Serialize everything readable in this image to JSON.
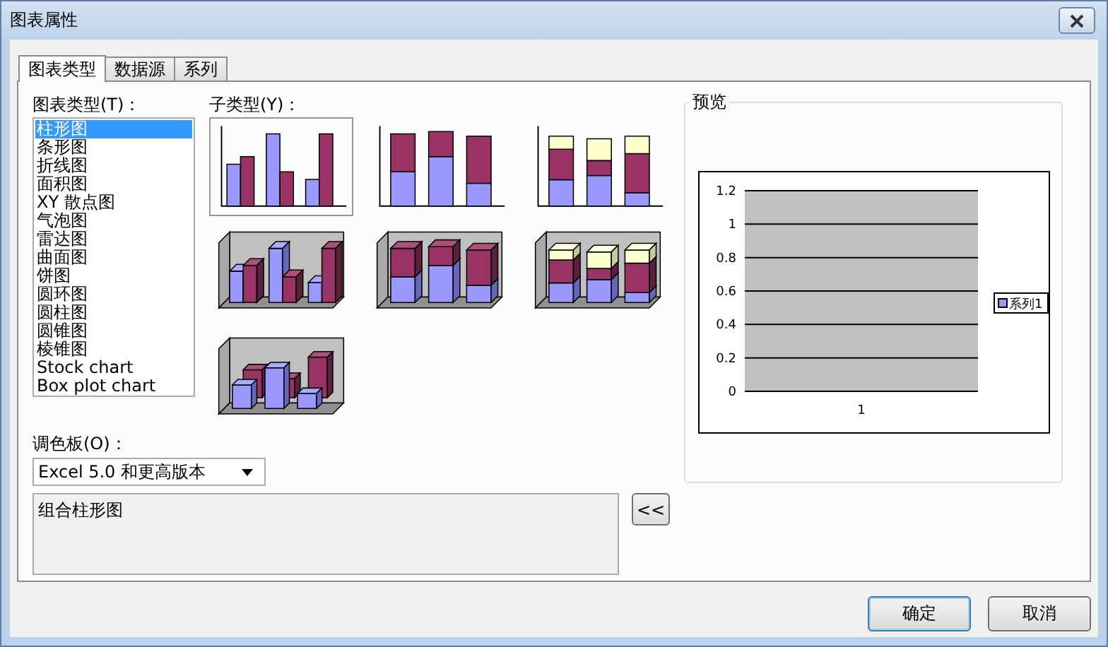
{
  "window": {
    "title": "图表属性"
  },
  "tabs": [
    {
      "label": "图表类型",
      "selected": true
    },
    {
      "label": "数据源",
      "selected": false
    },
    {
      "label": "系列",
      "selected": false
    }
  ],
  "chart_types": {
    "label": "图表类型(T)：",
    "items": [
      {
        "label": "柱形图",
        "selected": true
      },
      {
        "label": "条形图",
        "selected": false
      },
      {
        "label": "折线图",
        "selected": false
      },
      {
        "label": "面积图",
        "selected": false
      },
      {
        "label": "XY 散点图",
        "selected": false
      },
      {
        "label": "气泡图",
        "selected": false
      },
      {
        "label": "雷达图",
        "selected": false
      },
      {
        "label": "曲面图",
        "selected": false
      },
      {
        "label": "饼图",
        "selected": false
      },
      {
        "label": "圆环图",
        "selected": false
      },
      {
        "label": "圆柱图",
        "selected": false
      },
      {
        "label": "圆锥图",
        "selected": false
      },
      {
        "label": "棱锥图",
        "selected": false
      },
      {
        "label": "Stock chart",
        "selected": false
      },
      {
        "label": "Box plot chart",
        "selected": false
      }
    ]
  },
  "subtypes": {
    "label": "子类型(Y)：",
    "items": [
      {
        "kind": "clustered",
        "selected": true
      },
      {
        "kind": "stacked",
        "selected": false
      },
      {
        "kind": "percent",
        "selected": false
      },
      {
        "kind": "clustered3d",
        "selected": false
      },
      {
        "kind": "stacked3d",
        "selected": false
      },
      {
        "kind": "percent3d",
        "selected": false
      },
      {
        "kind": "column3d",
        "selected": false
      }
    ]
  },
  "palette": {
    "label": "调色板(O)：",
    "value": "Excel 5.0 和更高版本"
  },
  "description": "组合柱形图",
  "collapse_button": "<<",
  "preview": {
    "label": "预览",
    "chart_data": {
      "type": "bar",
      "categories": [
        "1"
      ],
      "series": [
        {
          "name": "系列1",
          "color": "#9999ff",
          "values": [
            null
          ]
        }
      ],
      "ylim": [
        0,
        1.2
      ],
      "yticks": [
        0,
        0.2,
        0.4,
        0.6,
        0.8,
        1,
        1.2
      ],
      "grid": true
    }
  },
  "buttons": [
    {
      "label": "确定",
      "default": true
    },
    {
      "label": "取消",
      "default": false
    }
  ]
}
